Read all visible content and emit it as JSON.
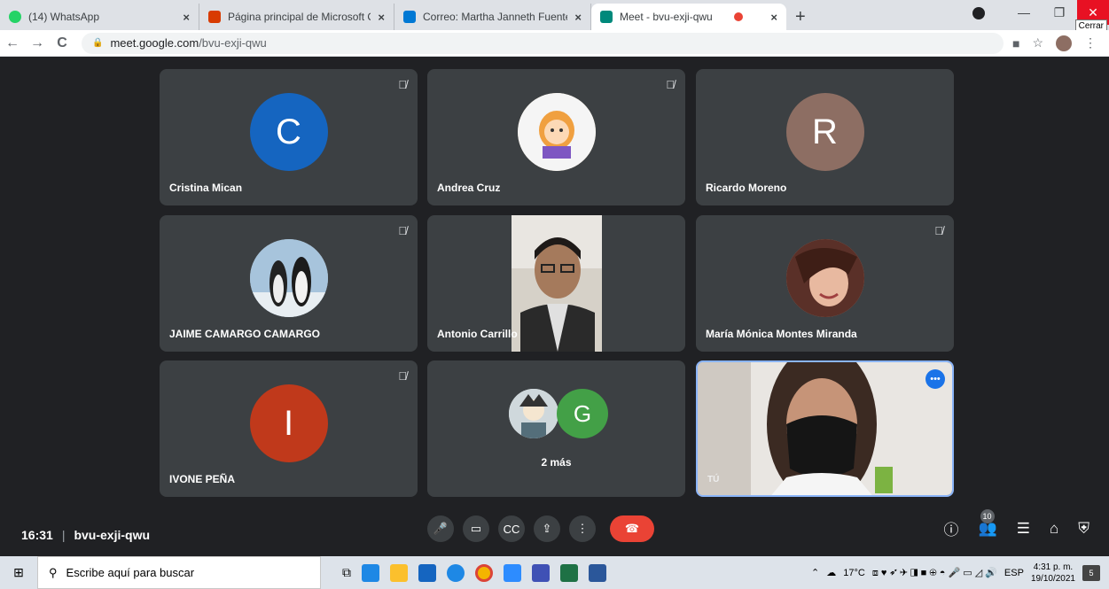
{
  "browser": {
    "tabs": [
      {
        "label": "(14) WhatsApp",
        "close": "×",
        "color": "#25d366"
      },
      {
        "label": "Página principal de Microsoft Off",
        "close": "×",
        "color": "#d83b01"
      },
      {
        "label": "Correo: Martha Janneth Fuentes",
        "close": "×",
        "color": "#0078d4"
      },
      {
        "label": "Meet - bvu-exji-qwu",
        "close": "×",
        "color": "#00897b"
      }
    ],
    "new_tab": "+",
    "close_tooltip": "Cerrar",
    "address": {
      "domain": "meet.google.com",
      "path": "/bvu-exji-qwu"
    },
    "nav": {
      "back": "←",
      "forward": "→",
      "reload": "C"
    }
  },
  "participants": [
    {
      "name": "Cristina Mican",
      "initial": "C",
      "avatar_color": "#1565c0",
      "muted": true
    },
    {
      "name": "Andrea Cruz",
      "initial": "",
      "avatar_color": "#f7d9a8",
      "muted": true
    },
    {
      "name": "Ricardo Moreno",
      "initial": "R",
      "avatar_color": "#8d6e63",
      "muted": false
    },
    {
      "name": "JAIME CAMARGO CAMARGO",
      "initial": "",
      "avatar_color": "#90a4ae",
      "muted": true
    },
    {
      "name": "Antonio Carrillo",
      "initial": "",
      "avatar_color": "#6b6257",
      "muted": false
    },
    {
      "name": "María Mónica Montes Miranda",
      "initial": "",
      "avatar_color": "#c48b7a",
      "muted": true
    },
    {
      "name": "IVONE PEÑA",
      "initial": "I",
      "avatar_color": "#c0391b",
      "muted": true
    },
    {
      "name": "2 más",
      "initial": "G",
      "avatar_color": "#43a047",
      "muted": false
    },
    {
      "name": "TÚ",
      "initial": "",
      "avatar_color": "#8b7d72",
      "muted": false
    }
  ],
  "meeting": {
    "time": "16:31",
    "code": "bvu-exji-qwu",
    "participant_count": "10"
  },
  "taskbar": {
    "search_placeholder": "Escribe aquí para buscar",
    "temperature": "17°C",
    "language": "ESP",
    "time": "4:31 p. m.",
    "date": "19/10/2021",
    "notifications": "5"
  }
}
